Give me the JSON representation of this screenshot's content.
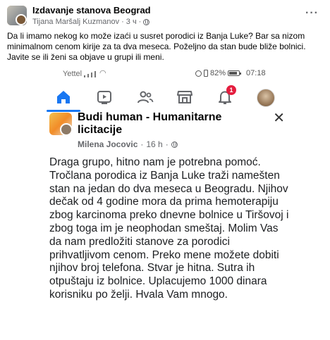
{
  "post": {
    "group_name": "Izdavanje stanova Beograd",
    "author": "Tijana Maršalj Kuzmanov",
    "time": "3 ч",
    "dot": "·",
    "more_icon": "more-horizontal-icon",
    "text": "Da li imamo nekog ko može izaći u susret porodici iz Banja Luke? Bar sa nizom minimalnom cenom kirije za ta dva meseca. Poželjno da stan bude bliže bolnici. Javite se ili ženi sa objave u grupi ili meni."
  },
  "screenshot": {
    "status_bar": {
      "carrier": "Yettel",
      "battery_percent": "82%",
      "time": "07:18"
    },
    "nav": {
      "items": [
        "home-icon",
        "video-icon",
        "friends-icon",
        "marketplace-icon",
        "notifications-icon",
        "profile-avatar"
      ],
      "active": "home-icon",
      "notification_count": "1"
    },
    "group_post": {
      "title": "Budi human - Humanitarne licitacije",
      "author": "Milena Jocovic",
      "time": "16 h",
      "dot": "·",
      "body": "Draga grupo, hitno nam je potrebna pomoć. Tročlana porodica iz Banja Luke traži namešten stan na jedan do dva meseca u Beogradu. Njihov dečak od 4 godine mora da prima hemoterapiju zbog karcinoma preko dnevne bolnice u Tiršovoj i zbog toga im je neophodan smeštaj. Molim Vas da nam predložiti stanove za porodici prihvatljivom cenom. Preko mene možete dobiti njihov broj telefona. Stvar je hitna. Sutra ih otpuštaju iz bolnice. Uplacujemo 1000 dinara korisniku po želji. Hvala Vam mnogo."
    }
  }
}
